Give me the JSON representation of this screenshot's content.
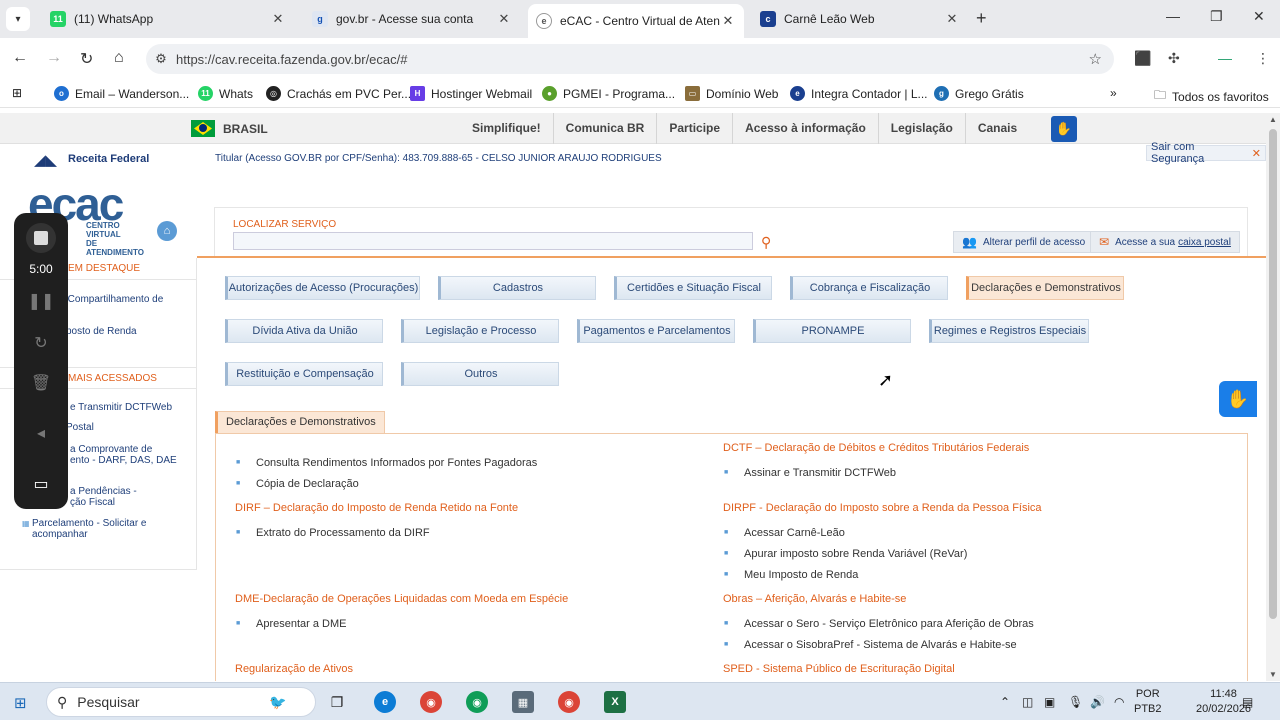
{
  "browser": {
    "tabs": [
      {
        "title": "(11) WhatsApp",
        "favicon": "11",
        "color": "#25d366",
        "active": false
      },
      {
        "title": "gov.br - Acesse sua conta",
        "favicon": "gov",
        "color": "#1351b4",
        "active": false
      },
      {
        "title": "eCAC - Centro Virtual de Atendimento",
        "favicon": "e",
        "color": "#555",
        "active": true
      },
      {
        "title": "Carnê Leão Web",
        "favicon": "cl",
        "color": "#1a3f8f",
        "active": false
      }
    ],
    "url": "https://cav.receita.fazenda.gov.br/ecac/#",
    "bookmarks": [
      {
        "label": "Email – Wanderson...",
        "color": "#1f6fd1"
      },
      {
        "label": "Whats",
        "color": "#25d366"
      },
      {
        "label": "Crachás em PVC Per...",
        "color": "#222"
      },
      {
        "label": "Hostinger Webmail",
        "color": "#673de6"
      },
      {
        "label": "PGMEI - Programa...",
        "color": "#5aa02c"
      },
      {
        "label": "Domínio Web",
        "color": "#8a6d3b"
      },
      {
        "label": "Integra Contador | L...",
        "color": "#1a3f8f"
      },
      {
        "label": "Grego Grátis",
        "color": "#1f6fb4"
      }
    ],
    "all_bookmarks": "Todos os favoritos"
  },
  "govbar": {
    "brasil": "BRASIL",
    "links": [
      "Simplifique!",
      "Comunica BR",
      "Participe",
      "Acesso à informação",
      "Legislação",
      "Canais"
    ]
  },
  "header": {
    "rf_logo": "Receita Federal",
    "ecac_logo": "ecac",
    "ecac_sub1": "CENTRO VIRTUAL",
    "ecac_sub2": "DE ATENDIMENTO",
    "titular": "Titular (Acesso GOV.BR por CPF/Senha): 483.709.888-65 - CELSO JUNIOR ARAUJO RODRIGUES",
    "logout": "Sair com Segurança"
  },
  "search": {
    "label": "LOCALIZAR SERVIÇO",
    "placeholder": "",
    "profile": "Alterar perfil de acesso",
    "mailbox_prefix": "Acesse a sua",
    "mailbox_link": "caixa postal"
  },
  "sidebar": {
    "destaque_title": "EM DESTAQUE",
    "destaque": [
      {
        "line1": "ar Compartilhamento de",
        "line2": ""
      },
      {
        "line1": "posto de Renda",
        "line2": ""
      }
    ],
    "acessados_title": "MAIS ACESSADOS",
    "acessados": [
      {
        "line1": "e Transmitir DCTFWeb",
        "line2": ""
      },
      {
        "line1": "Postal",
        "line2": ""
      },
      {
        "line1": "a Comprovante de",
        "line2": "ento - DARF, DAS, DAE"
      },
      {
        "line1": "a Pendências -",
        "line2": "ção Fiscal"
      },
      {
        "line1": "Parcelamento - Solicitar e",
        "line2": "acompanhar"
      }
    ]
  },
  "services": [
    "Autorizações de Acesso (Procurações)",
    "Cadastros",
    "Certidões e Situação Fiscal",
    "Cobrança e Fiscalização",
    "Declarações e Demonstrativos",
    "Dívida Ativa da União",
    "Legislação e Processo",
    "Pagamentos e Parcelamentos",
    "PRONAMPE",
    "Regimes e Registros Especiais",
    "Restituição e Compensação",
    "Outros"
  ],
  "section": {
    "title": "Declarações e Demonstrativos",
    "left": {
      "items_top": [
        "Consulta Rendimentos Informados por Fontes Pagadoras",
        "Cópia de Declaração"
      ],
      "g1": "DIRF – Declaração do Imposto de Renda Retido na Fonte",
      "g1_items": [
        "Extrato do Processamento da DIRF"
      ],
      "g2": "DME-Declaração de Operações Liquidadas com Moeda em Espécie",
      "g2_items": [
        "Apresentar a DME"
      ],
      "g3": "Regularização de Ativos"
    },
    "right": {
      "g1": "DCTF – Declaração de Débitos e Créditos Tributários Federais",
      "g1_items": [
        "Assinar e Transmitir DCTFWeb"
      ],
      "g2": "DIRPF - Declaração do Imposto sobre a Renda da Pessoa Física",
      "g2_items": [
        "Acessar Carnê-Leão",
        "Apurar imposto sobre Renda Variável (ReVar)",
        "Meu Imposto de Renda"
      ],
      "g3": "Obras – Aferição, Alvarás e Habite-se",
      "g3_items": [
        "Acessar o Sero - Serviço Eletrônico para Aferição de Obras",
        "Acessar o SisobraPref - Sistema de Alvarás e Habite-se"
      ],
      "g4": "SPED - Sistema Público de Escrituração Digital"
    }
  },
  "recorder": {
    "time": "5:00"
  },
  "taskbar": {
    "search": "Pesquisar",
    "lang1": "POR",
    "lang2": "PTB2",
    "time": "11:48",
    "date": "20/02/2026"
  }
}
